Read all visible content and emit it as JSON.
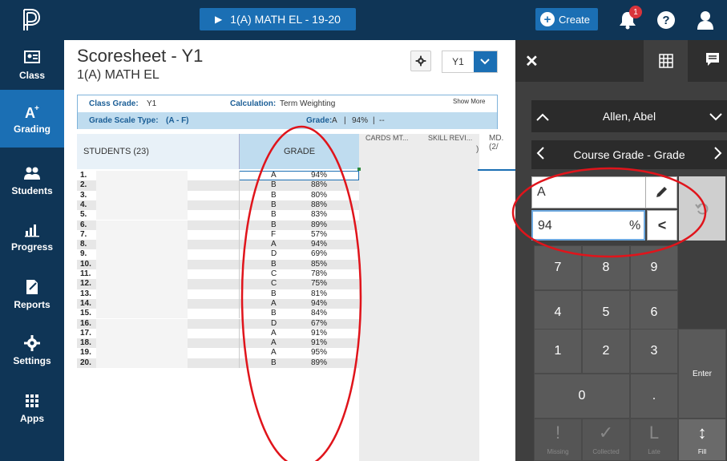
{
  "topbar": {
    "section_label": "1(A) MATH EL  -  19-20",
    "create_label": "Create",
    "notification_count": "1",
    "help_label": "?"
  },
  "sidebar": {
    "items": [
      {
        "label": "Class",
        "icon": "class-icon"
      },
      {
        "label": "Grading",
        "icon": "grading-icon"
      },
      {
        "label": "Students",
        "icon": "students-icon"
      },
      {
        "label": "Progress",
        "icon": "progress-icon"
      },
      {
        "label": "Reports",
        "icon": "reports-icon"
      },
      {
        "label": "Settings",
        "icon": "settings-icon"
      },
      {
        "label": "Apps",
        "icon": "apps-icon"
      }
    ],
    "active": "Grading"
  },
  "main": {
    "title": "Scoresheet - Y1",
    "subtitle": "1(A) MATH EL",
    "term": "Y1",
    "info": {
      "class_grade_label": "Class Grade:",
      "class_grade_value": "Y1",
      "calculation_label": "Calculation:",
      "calculation_value": "Term Weighting",
      "show_more": "Show More",
      "grade_scale_label": "Grade Scale Type:",
      "grade_scale_value": "(A - F)",
      "grade_label": "Grade:",
      "grade_value": "A",
      "grade_sep": "|",
      "grade_pct": "94%",
      "grade_sep2": "|",
      "grade_dash": "--"
    },
    "table": {
      "students_header": "STUDENTS (23)",
      "grade_header": "GRADE",
      "col_cut1": "CARDS MT...",
      "col_cut2": "SKILL REVI...",
      "col_cut3": "MD.",
      "col_cut3b": "(2/",
      "col_cut_paren": ")",
      "rows": [
        {
          "num": "1.",
          "letter": "A",
          "pct": "94%"
        },
        {
          "num": "2.",
          "letter": "B",
          "pct": "88%"
        },
        {
          "num": "3.",
          "letter": "B",
          "pct": "80%"
        },
        {
          "num": "4.",
          "letter": "B",
          "pct": "88%"
        },
        {
          "num": "5.",
          "letter": "B",
          "pct": "83%"
        },
        {
          "num": "6.",
          "letter": "B",
          "pct": "89%"
        },
        {
          "num": "7.",
          "letter": "F",
          "pct": "57%"
        },
        {
          "num": "8.",
          "letter": "A",
          "pct": "94%"
        },
        {
          "num": "9.",
          "letter": "D",
          "pct": "69%"
        },
        {
          "num": "10.",
          "letter": "B",
          "pct": "85%"
        },
        {
          "num": "11.",
          "letter": "C",
          "pct": "78%"
        },
        {
          "num": "12.",
          "letter": "C",
          "pct": "75%"
        },
        {
          "num": "13.",
          "letter": "B",
          "pct": "81%"
        },
        {
          "num": "14.",
          "letter": "A",
          "pct": "94%"
        },
        {
          "num": "15.",
          "letter": "B",
          "pct": "84%"
        },
        {
          "num": "16.",
          "letter": "D",
          "pct": "67%"
        },
        {
          "num": "17.",
          "letter": "A",
          "pct": "91%"
        },
        {
          "num": "18.",
          "letter": "A",
          "pct": "91%"
        },
        {
          "num": "19.",
          "letter": "A",
          "pct": "95%"
        },
        {
          "num": "20.",
          "letter": "B",
          "pct": "89%"
        }
      ]
    }
  },
  "panel": {
    "student_name": "Allen, Abel",
    "column_name": "Course Grade - Grade",
    "grade_letter": "A",
    "grade_pct": "94",
    "pct_symbol": "%",
    "back_symbol": "<",
    "keys": [
      "7",
      "8",
      "9",
      "4",
      "5",
      "6",
      "1",
      "2",
      "3",
      "0",
      "."
    ],
    "enter_label": "Enter",
    "tools": [
      {
        "label": "Missing",
        "icon": "!"
      },
      {
        "label": "Collected",
        "icon": "✓"
      },
      {
        "label": "Late",
        "icon": "L"
      },
      {
        "label": "Fill",
        "icon": "↕"
      }
    ]
  },
  "colors": {
    "nav_bg": "#0f3556",
    "accent": "#1b6fb4",
    "panel_bg": "#3f3f3f",
    "annotation_red": "#e0141b"
  }
}
